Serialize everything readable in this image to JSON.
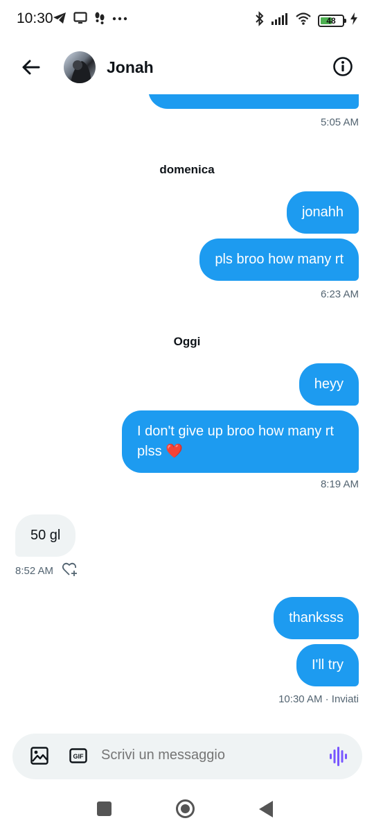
{
  "status_bar": {
    "time": "10:30",
    "battery_percent": "48",
    "icons": [
      "telegram-icon",
      "cast-icon",
      "footprints-icon",
      "more-dots-icon",
      "bluetooth-icon",
      "signal-icon",
      "wifi-icon",
      "battery-icon",
      "charging-icon"
    ]
  },
  "header": {
    "contact_name": "Jonah",
    "back_icon": "arrow-left-icon",
    "info_icon": "info-circle-icon"
  },
  "messages": {
    "m0_time": "5:05 AM",
    "sep1": "domenica",
    "m1_text": "jonahh",
    "m2_text": "pls broo how many rt",
    "m2_time": "6:23 AM",
    "sep2": "Oggi",
    "m3_text": "heyy",
    "m4_line1": "I don't give up broo how many rt",
    "m4_line2": "plss",
    "m4_emoji": "❤️",
    "m4_time": "8:19 AM",
    "m5_text": "50 gl",
    "m5_time": "8:52 AM",
    "m6_text": "thanksss",
    "m7_text": "I'll try",
    "m7_status": "10:30 AM · Inviati"
  },
  "composer": {
    "placeholder": "Scrivi un messaggio",
    "gif_label": "GIF",
    "image_icon": "image-icon",
    "voice_icon": "voice-wave-icon"
  },
  "colors": {
    "accent": "#1d9bf0",
    "incoming_bubble": "#eff3f4",
    "meta_text": "#536471",
    "voice": "#7856ff",
    "battery": "#4caf50"
  }
}
